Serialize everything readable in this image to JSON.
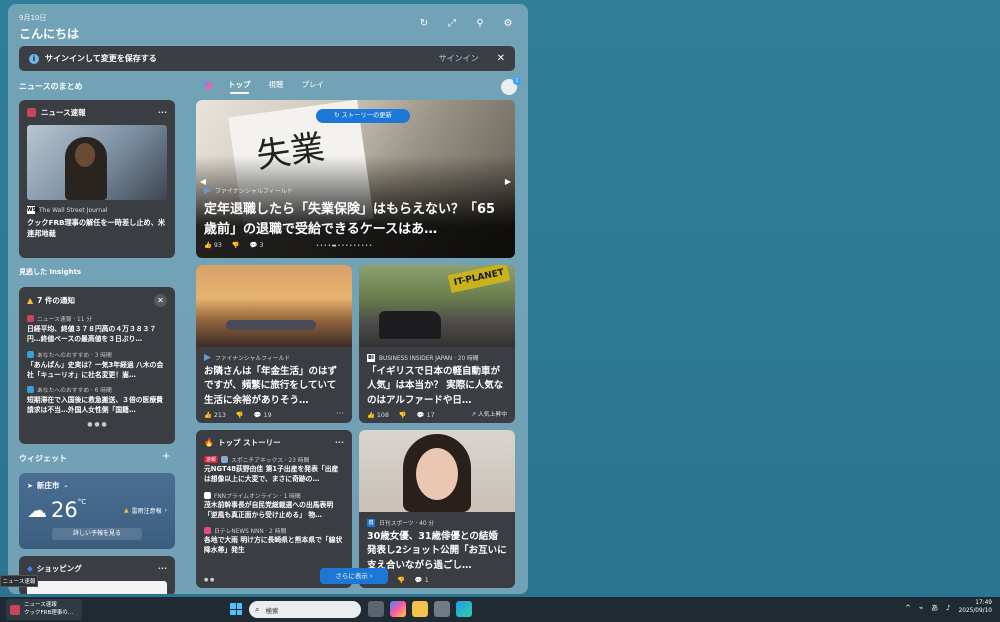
{
  "panel": {
    "date": "9月10日",
    "greeting": "こんにちは",
    "colors": {
      "accent": "#1d77d6",
      "panel_bg": "#78a5b9",
      "card_bg": "#3a3d41"
    }
  },
  "signin": {
    "text": "サインインして変更を保存する",
    "link": "サインイン"
  },
  "sections": {
    "news_summary": "ニュースのまとめ",
    "missed_insights": "見逃した Insights",
    "widgets": "ウィジェット",
    "plus": "+"
  },
  "news_card": {
    "title": "ニュース速報",
    "source": "The Wall Street Journal",
    "headline": "クックFRB理事の解任を一時差し止め、米連邦地裁"
  },
  "notifications": {
    "title": "7 件の通知",
    "items": [
      {
        "meta": "ニュース速報 · 11 分",
        "text": "日経平均、終値３７８円高の４万３８３７円…終値ベースの最高値を３日ぶり…"
      },
      {
        "meta": "あなたへのおすすめ · 3 時間",
        "text": "「あんぱん」史実は？一気3年経過 八木の会社「キューリオ」に社名変更！嵩…"
      },
      {
        "meta": "あなたへのおすすめ · 6 時間",
        "text": "短期滞在で入国後に救急搬送、３倍の医療費請求は不当…外国人女性側「国籍…"
      }
    ]
  },
  "weather": {
    "city": "新庄市",
    "temp": "26",
    "unit": "°C",
    "alert": "雷雨注意報",
    "button": "詳しい予報を見る"
  },
  "shopping": {
    "title": "ショッピング"
  },
  "tabs": [
    "トップ",
    "視聴",
    "プレイ"
  ],
  "hero": {
    "refresh": "ストーリーの更新",
    "source": "ファイナンシャルフィールド",
    "headline": "定年退職したら「失業保険」はもらえない？「65歳前」の退職で受給できるケースはあ…",
    "likes": "93",
    "comments": "3",
    "paper_text": "失業"
  },
  "card_a": {
    "source": "ファイナンシャルフィールド",
    "headline": "お隣さんは「年金生活」のはずですが、頻繁に旅行をしていて生活に余裕がありそう…",
    "likes": "213",
    "comments": "19"
  },
  "card_b": {
    "source": "BUSINESS INSIDER JAPAN · 20 時間",
    "headline": "「イギリスで日本の軽自動車が人気」は本当か？ 実際に人気なのはアルファードや日…",
    "likes": "108",
    "comments": "17",
    "trend": "人気上昇中",
    "sign": "IT-PLANET"
  },
  "top_stories": {
    "title": "トップ ストーリー",
    "breaking": "速報",
    "items": [
      {
        "meta": "スポニチアネックス · 23 時間",
        "text": "元NGT48荻野由佳 第1子出産を発表「出産は想像以上に大変で、まさに奇跡の…"
      },
      {
        "meta": "FNNプライムオンライン · 1 時間",
        "text": "茂木前幹事長が自民党総裁選への出馬表明「逆風も真正面から受け止める」 物…"
      },
      {
        "meta": "日テレNEWS NNN · 2 時間",
        "text": "各地で大雨 明け方に長崎県と熊本県で「線状降水帯」発生"
      }
    ]
  },
  "portrait_card": {
    "source": "日刊スポーツ · 40 分",
    "headline": "30歳女優、31歳俳優との結婚発表し2ショット公開「お互いに支え合いながら過ごし…",
    "comments": "1"
  },
  "more_button": "さらに表示",
  "taskbar": {
    "tooltip": "ニュース速報",
    "widget_line1": "ニュース速報",
    "widget_line2": "クックFRB理事の…",
    "search_placeholder": "検索",
    "ime": "あ",
    "time": "17:49",
    "date": "2025/09/10"
  }
}
